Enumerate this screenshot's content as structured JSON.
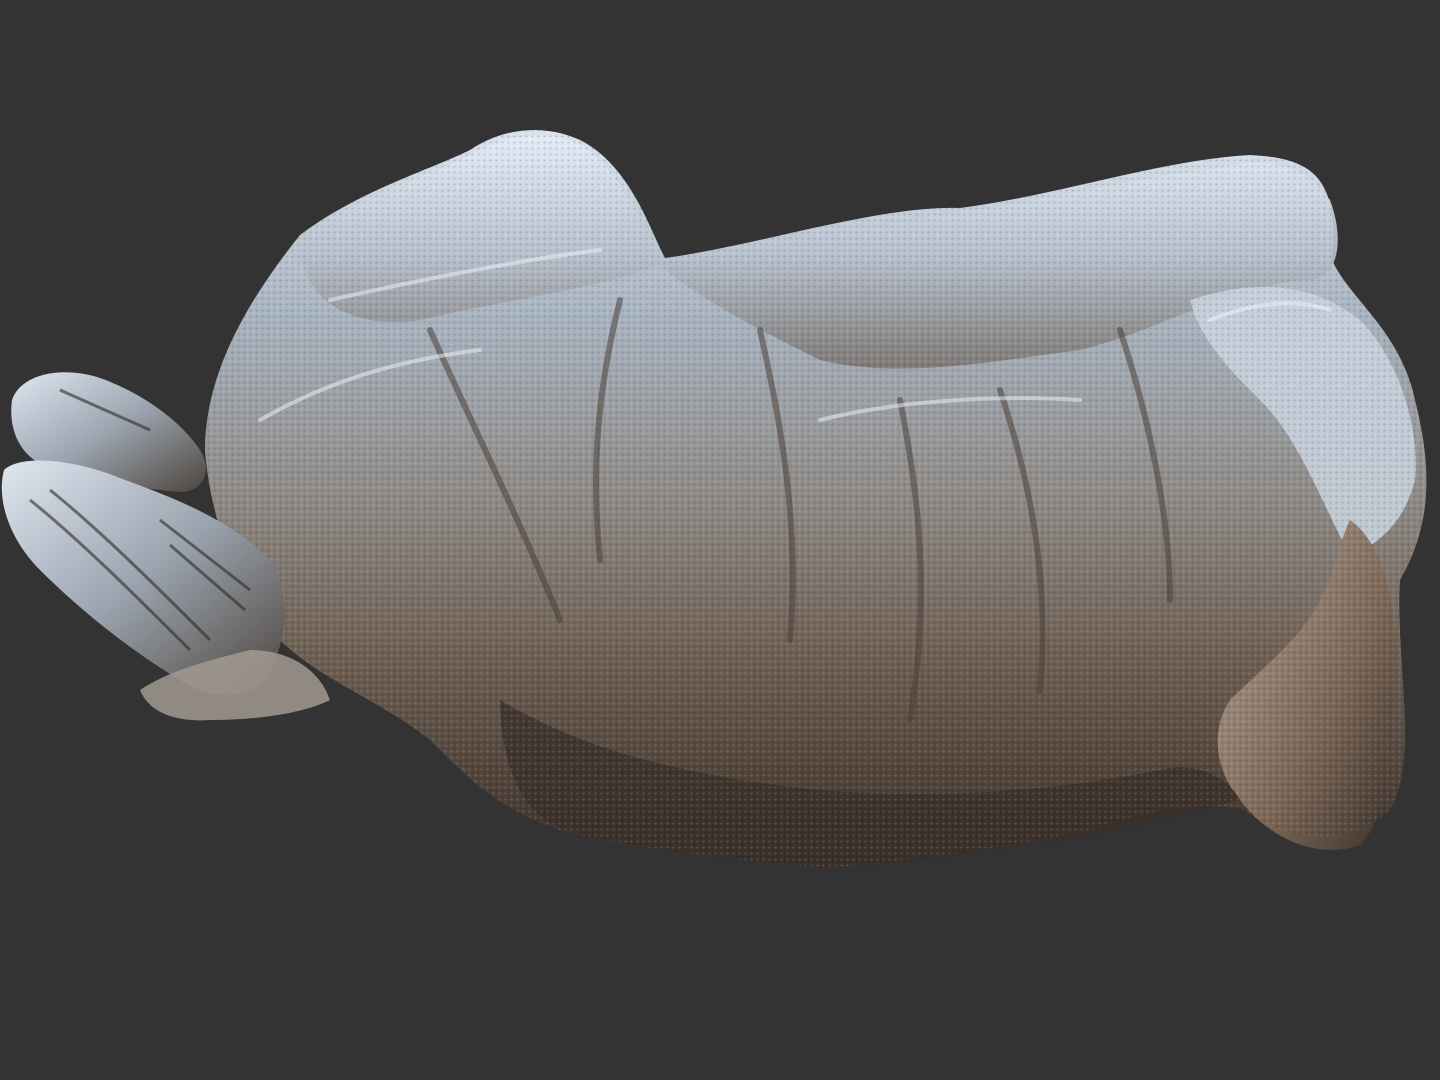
{
  "viewport": {
    "background_color": "#333333",
    "subject": "scan-render",
    "material_colors": {
      "highlight": "#dde6f2",
      "midtone": "#8d96a2",
      "warm": "#a98f7a",
      "shadow": "#3e362f",
      "deep_shadow": "#2a241f"
    }
  }
}
